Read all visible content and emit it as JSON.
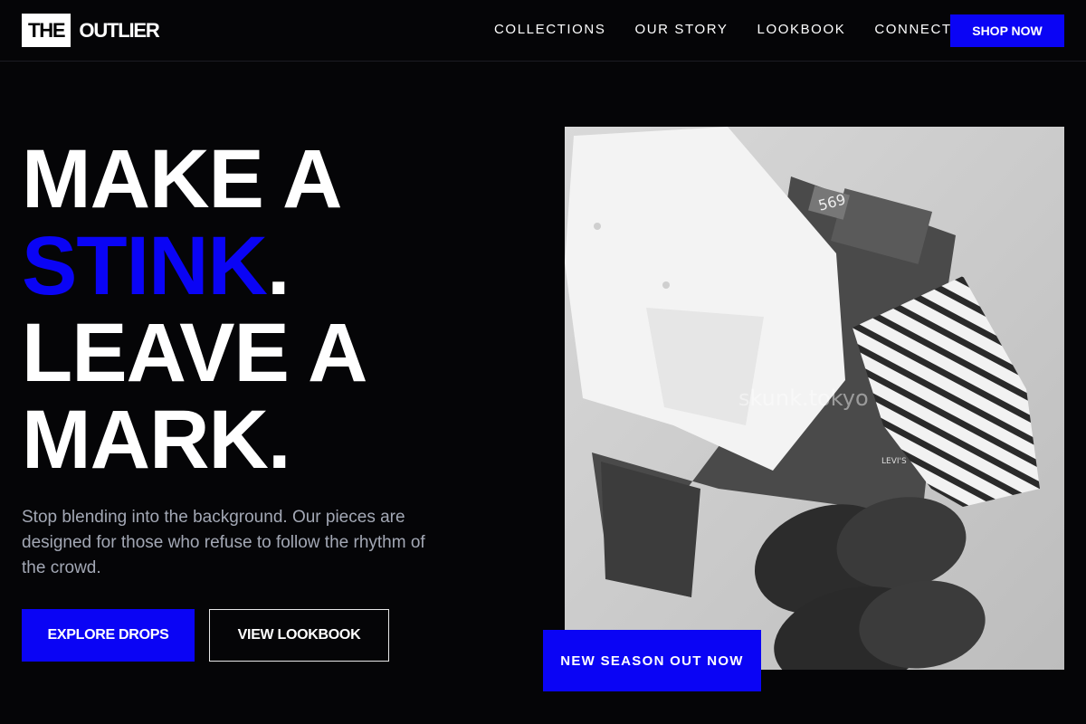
{
  "brand": {
    "box": "THE",
    "name": "OUTLIER"
  },
  "nav": {
    "items": [
      {
        "label": "COLLECTIONS"
      },
      {
        "label": "OUR STORY"
      },
      {
        "label": "LOOKBOOK"
      },
      {
        "label": "CONNECT"
      }
    ],
    "cta": "SHOP NOW"
  },
  "hero": {
    "line1": "MAKE A",
    "line2_word": "STINK",
    "line2_dot": ".",
    "line3": "LEAVE A",
    "line4": "MARK.",
    "description": "Stop blending into the background. Our pieces are designed for those who refuse to follow the rhythm of the crowd.",
    "primary_button": "EXPLORE DROPS",
    "secondary_button": "VIEW LOOKBOOK"
  },
  "image": {
    "watermark": "skunk.tokyo",
    "jeans_tag": "569",
    "label_small": "LEVI'S"
  },
  "badge": {
    "label": "NEW SEASON OUT NOW"
  },
  "colors": {
    "accent": "#0a04f5",
    "background": "#050507",
    "muted_text": "#a3a8b5"
  }
}
